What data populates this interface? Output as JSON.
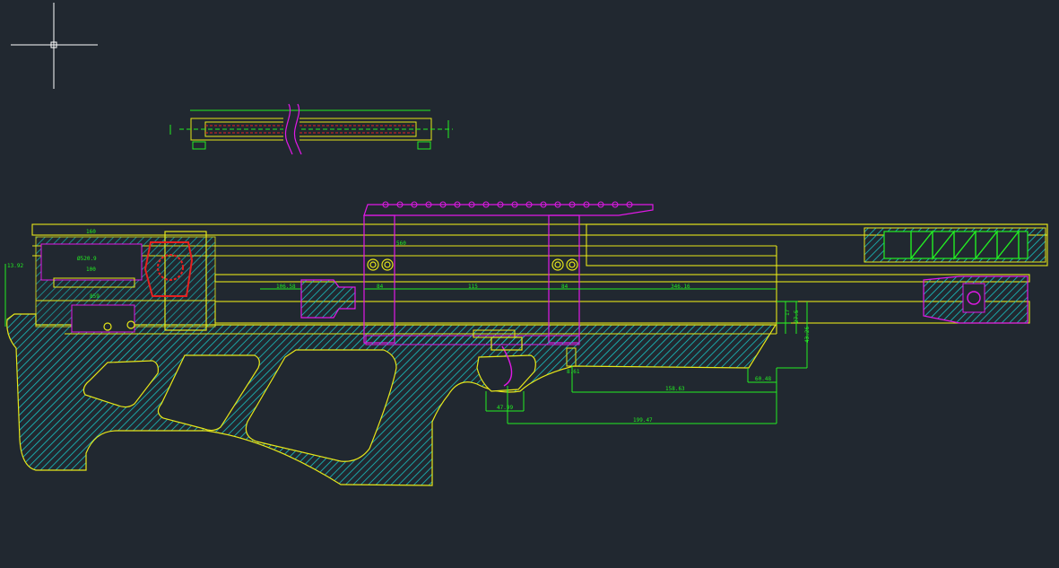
{
  "colors": {
    "background": "#212830",
    "outline": "#e6e619",
    "hatch": "#19c3c3",
    "dimension": "#22ee22",
    "accent": "#e019e6",
    "detail": "#e62020",
    "cursor": "#ffffff"
  },
  "cursor": {
    "icon": "crosshair-cursor-icon"
  },
  "dimensions": {
    "stock_height": "13.92",
    "barrel_label": "560",
    "length_a": "106.58",
    "length_b": "84",
    "length_c": "115",
    "length_d": "84",
    "length_e": "346.16",
    "height_a": "17",
    "height_b": "27.5",
    "height_c": "43.26",
    "trigger_guard": "60.48",
    "grip_to_end_a": "158.63",
    "grip_width": "47.99",
    "grip_to_end_b": "199.47",
    "pin_size": "8.61",
    "receiver_label": "100",
    "detail_label_a": "160",
    "detail_label_b": "Ø520.9",
    "detail_label_c": "859"
  }
}
